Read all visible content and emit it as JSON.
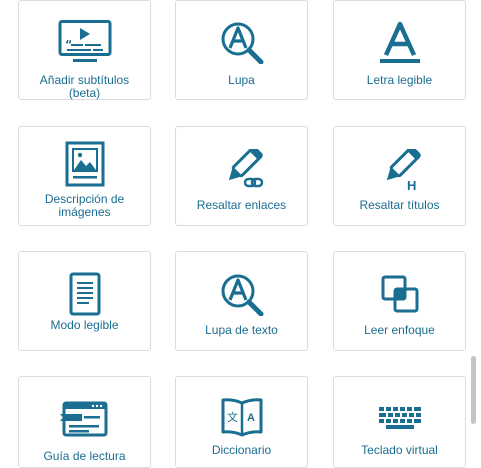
{
  "colors": {
    "accent": "#1a6e91",
    "border": "#d9dde2",
    "scrollbar": "#c4c4c4"
  },
  "tools": [
    {
      "label": "Añadir subtítulos (beta)",
      "icon": "video-subtitles-icon"
    },
    {
      "label": "Lupa",
      "icon": "magnifier-a-icon"
    },
    {
      "label": "Letra legible",
      "icon": "readable-font-a-icon"
    },
    {
      "label": "Descripción de imágenes",
      "icon": "image-description-icon"
    },
    {
      "label": "Resaltar enlaces",
      "icon": "pen-link-icon"
    },
    {
      "label": "Resaltar títulos",
      "icon": "pen-heading-icon"
    },
    {
      "label": "Modo legible",
      "icon": "document-icon"
    },
    {
      "label": "Lupa de texto",
      "icon": "text-magnifier-icon"
    },
    {
      "label": "Leer enfoque",
      "icon": "focus-squares-icon"
    },
    {
      "label": "Guía de lectura",
      "icon": "reading-guide-icon"
    },
    {
      "label": "Diccionario",
      "icon": "dictionary-book-icon"
    },
    {
      "label": "Teclado virtual",
      "icon": "keyboard-icon"
    }
  ],
  "dictionary_icon_glyphs": {
    "left": "文",
    "right": "A"
  },
  "heading_glyph": "H"
}
